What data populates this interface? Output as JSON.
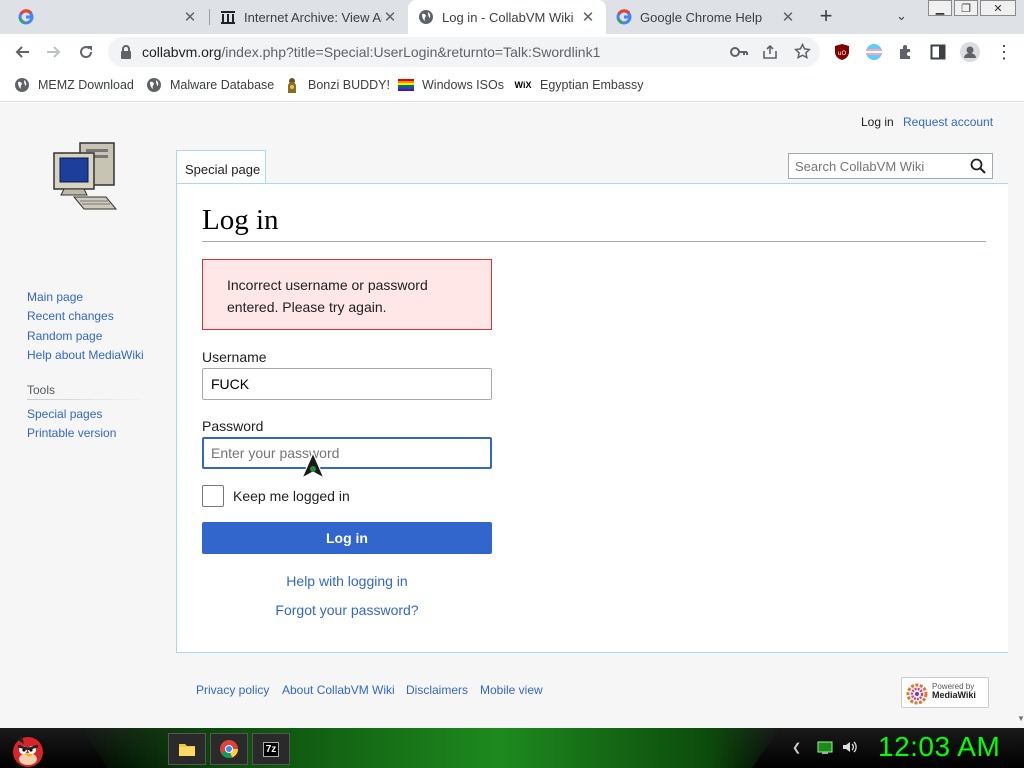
{
  "tabs": [
    {
      "title": "",
      "icon": "google-icon"
    },
    {
      "title": "Internet Archive: View Ar",
      "icon": "archive-icon"
    },
    {
      "title": "Log in - CollabVM Wiki",
      "icon": "globe-icon",
      "active": true
    },
    {
      "title": "Google Chrome Help",
      "icon": "google-icon"
    }
  ],
  "toolbar": {
    "url_host": "collabvm.org",
    "url_path": "/index.php?title=Special:UserLogin&returnto=Talk:Swordlink1"
  },
  "bookmarks": [
    {
      "label": "MEMZ Download",
      "icon": "globe-icon"
    },
    {
      "label": "Malware Database",
      "icon": "globe-icon"
    },
    {
      "label": "Bonzi BUDDY!",
      "icon": "bonzi-icon"
    },
    {
      "label": "Windows ISOs",
      "icon": "rainbow-flag-icon"
    },
    {
      "label": "Egyptian Embassy",
      "icon": "wix-icon"
    }
  ],
  "wix_text": "WiX",
  "personal": {
    "login": "Log in",
    "request": "Request account"
  },
  "special_tab": "Special page",
  "search": {
    "placeholder": "Search CollabVM Wiki"
  },
  "sidebar": {
    "nav": [
      "Main page",
      "Recent changes",
      "Random page",
      "Help about MediaWiki"
    ],
    "tools_heading": "Tools",
    "tools": [
      "Special pages",
      "Printable version"
    ]
  },
  "login": {
    "heading": "Log in",
    "error_line1": "Incorrect username or password",
    "error_line2": "entered. Please try again.",
    "username_label": "Username",
    "username_value": "FUCK",
    "password_label": "Password",
    "password_placeholder": "Enter your password",
    "remember_label": "Keep me logged in",
    "submit_label": "Log in",
    "help_link": "Help with logging in",
    "forgot_link": "Forgot your password?"
  },
  "footer": {
    "links": [
      "Privacy policy",
      "About CollabVM Wiki",
      "Disclaimers",
      "Mobile view"
    ],
    "powered_line1": "Powered by",
    "powered_line2": "MediaWiki"
  },
  "taskbar": {
    "clock": "12:03 AM",
    "seven_zip_label": "7z"
  },
  "colors": {
    "link": "#3366cc",
    "button": "#3366cc",
    "error_bg": "#fee7e6",
    "error_border": "#d33",
    "clock": "#00ff00"
  }
}
